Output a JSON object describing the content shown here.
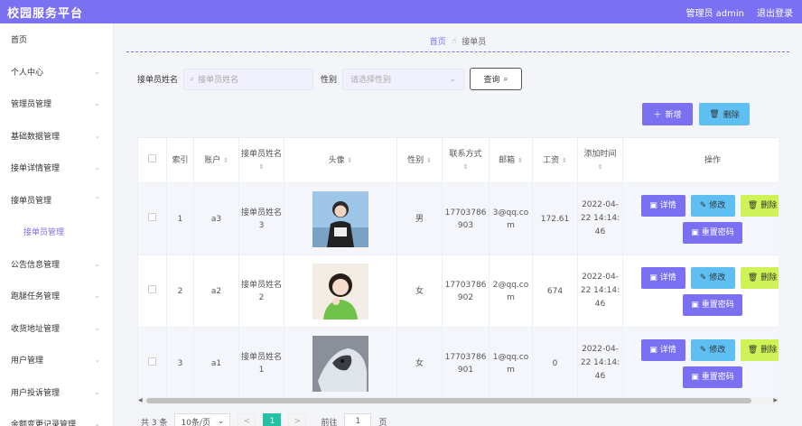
{
  "header": {
    "title": "校园服务平台",
    "user": "管理员 admin",
    "logout": "退出登录"
  },
  "sidebar": {
    "items": [
      {
        "label": "首页",
        "chevron": ""
      },
      {
        "label": "个人中心",
        "chevron": "⌄"
      },
      {
        "label": "管理员管理",
        "chevron": "⌄"
      },
      {
        "label": "基础数据管理",
        "chevron": "⌄"
      },
      {
        "label": "接单详情管理",
        "chevron": "⌄"
      },
      {
        "label": "接单员管理",
        "chevron": "⌃"
      },
      {
        "label": "接单员管理",
        "chevron": ""
      },
      {
        "label": "公告信息管理",
        "chevron": "⌄"
      },
      {
        "label": "跑腿任务管理",
        "chevron": "⌄"
      },
      {
        "label": "收货地址管理",
        "chevron": "⌄"
      },
      {
        "label": "用户管理",
        "chevron": "⌄"
      },
      {
        "label": "用户投诉管理",
        "chevron": "⌄"
      },
      {
        "label": "余额变更记录管理",
        "chevron": "⌄"
      }
    ]
  },
  "breadcrumb": {
    "home": "首页",
    "current": "接单员"
  },
  "search": {
    "name_label": "接单员姓名",
    "name_placeholder": "接单员姓名",
    "gender_label": "性别",
    "gender_placeholder": "请选择性别",
    "query_button": "查询"
  },
  "toolbar": {
    "add": "新增",
    "delete": "删除"
  },
  "table": {
    "headers": {
      "index": "索引",
      "account": "账户",
      "name": "接单员姓名",
      "avatar": "头像",
      "gender": "性别",
      "phone": "联系方式",
      "email": "邮箱",
      "salary": "工资",
      "added": "添加时间",
      "ops": "操作"
    },
    "rows": [
      {
        "index": "1",
        "account": "a3",
        "name": "接单员姓名3",
        "gender": "男",
        "phone": "17703786903",
        "email": "3@qq.com",
        "salary": "172.61",
        "added": "2022-04-22 14:14:46"
      },
      {
        "index": "2",
        "account": "a2",
        "name": "接单员姓名2",
        "gender": "女",
        "phone": "17703786902",
        "email": "2@qq.com",
        "salary": "674",
        "added": "2022-04-22 14:14:46"
      },
      {
        "index": "3",
        "account": "a1",
        "name": "接单员姓名1",
        "gender": "女",
        "phone": "17703786901",
        "email": "1@qq.com",
        "salary": "0",
        "added": "2022-04-22 14:14:46"
      }
    ],
    "ops": {
      "detail": "详情",
      "edit": "修改",
      "remove": "删除",
      "reset": "重置密码"
    }
  },
  "pagination": {
    "total": "共 3 条",
    "page_size": "10条/页",
    "prev": "<",
    "current": "1",
    "next": ">",
    "goto_prefix": "前往",
    "goto_value": "1",
    "goto_suffix": "页"
  },
  "colors": {
    "accent": "#7b6ff2",
    "info": "#5ec0f2",
    "lime": "#cff356",
    "teal": "#24c2a5"
  }
}
